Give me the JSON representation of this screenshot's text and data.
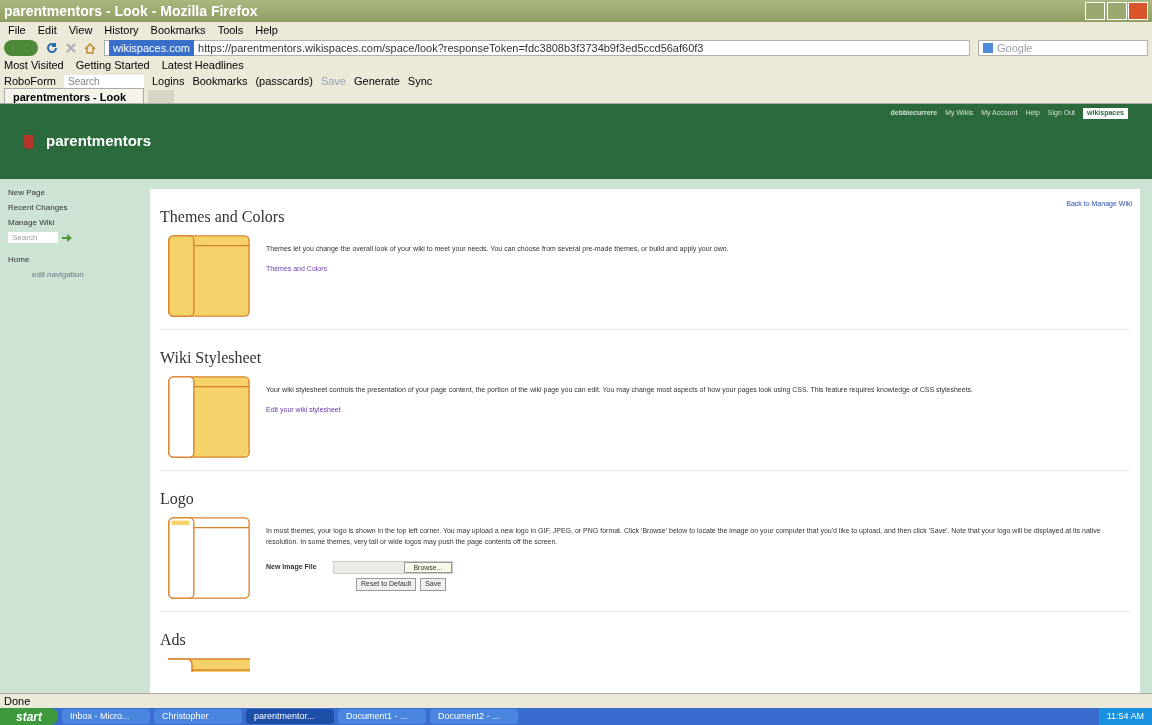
{
  "window": {
    "title": "parentmentors - Look - Mozilla Firefox"
  },
  "menu": [
    "File",
    "Edit",
    "View",
    "History",
    "Bookmarks",
    "Tools",
    "Help"
  ],
  "address_bar": {
    "site_badge": "wikispaces.com",
    "url": "https://parentmentors.wikispaces.com/space/look?responseToken=fdc3808b3f3734b9f3ed5ccd56af60f3"
  },
  "search_bar": {
    "placeholder": "Google"
  },
  "bookmarks": [
    "Most Visited",
    "Getting Started",
    "Latest Headlines"
  ],
  "roboform": {
    "label": "RoboForm",
    "search_placeholder": "Search",
    "items": [
      "Logins",
      "Bookmarks",
      "(passcards)",
      "Save",
      "Generate",
      "Sync"
    ]
  },
  "tabs": [
    {
      "label": "parentmentors - Look",
      "selected": true
    }
  ],
  "site": {
    "name": "parentmentors",
    "user_links": [
      "debbiecurrere",
      "My Wikis",
      "My Account",
      "Help",
      "Sign Out"
    ],
    "badge": "wikispaces"
  },
  "sidebar": {
    "items": [
      "New Page",
      "Recent Changes",
      "Manage Wiki"
    ],
    "search_placeholder": "Search",
    "nav": [
      "Home"
    ],
    "edit_link": "edit navigation"
  },
  "back_link": "Back to Manage Wiki",
  "sections": [
    {
      "title": "Themes and Colors",
      "thumbnail": {
        "kind": "full"
      },
      "description": "Themes let you change the overall look of your wiki to meet your needs. You can choose from several pre-made themes, or build and apply your own.",
      "kind": "link",
      "link": "Themes and Colors"
    },
    {
      "title": "Wiki Stylesheet",
      "thumbnail": {
        "kind": "content"
      },
      "description": "Your wiki stylesheet controls the presentation of your page content, the portion of the wiki page you can edit. You may change most aspects of how your pages look using CSS. This feature requires knowledge of CSS stylesheets.",
      "kind": "link",
      "link": "Edit your wiki stylesheet"
    },
    {
      "title": "Logo",
      "thumbnail": {
        "kind": "logo"
      },
      "description": "In most themes, your logo is shown in the top left corner. You may upload a new logo in GIF, JPEG, or PNG format. Click 'Browse' below to locate the image on your computer that you'd like to upload, and then click 'Save'. Note that your logo will be displayed at its native resolution. In some themes, very tall or wide logos may push the page contents off the screen.",
      "kind": "upload",
      "field_label": "New Image File",
      "browse": "Browse...",
      "buttons": [
        "Reset to Default",
        "Save"
      ]
    },
    {
      "title": "Ads",
      "thumbnail": {
        "kind": "content"
      },
      "kind": "partial"
    }
  ],
  "status_bar": "Done",
  "taskbar": {
    "start": "start",
    "items": [
      {
        "label": "Inbox - Micro...",
        "selected": false
      },
      {
        "label": "Christopher",
        "selected": false
      },
      {
        "label": "parentmentor...",
        "selected": true
      },
      {
        "label": "Document1 - ...",
        "selected": false
      },
      {
        "label": "Document2 - ...",
        "selected": false
      }
    ],
    "clock": "11:54 AM"
  }
}
